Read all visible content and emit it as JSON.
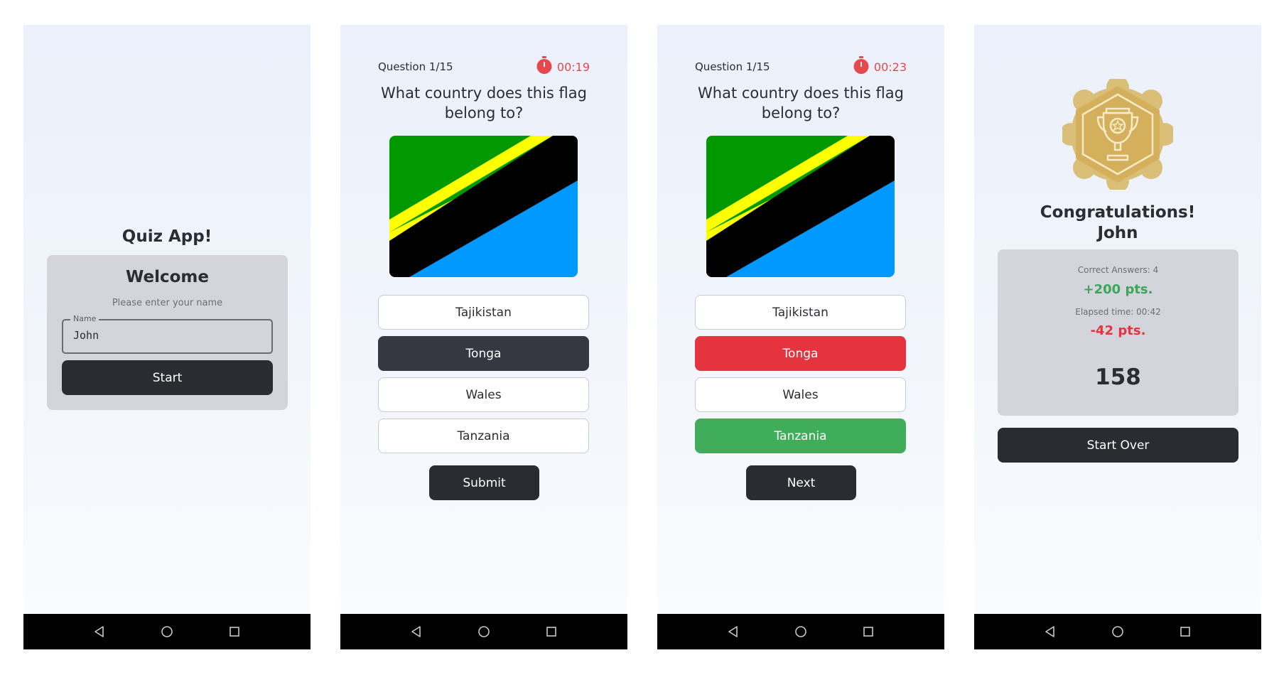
{
  "screen1": {
    "app_title": "Quiz App!",
    "welcome_title": "Welcome",
    "subtitle": "Please enter your name",
    "name_label": "Name",
    "name_value": "John",
    "start_label": "Start"
  },
  "screen2": {
    "question_label": "Question 1/15",
    "timer": "00:19",
    "question": "What country does this flag belong to?",
    "options": [
      "Tajikistan",
      "Tonga",
      "Wales",
      "Tanzania"
    ],
    "selected_option": "Tonga",
    "submit_label": "Submit"
  },
  "screen3": {
    "question_label": "Question 1/15",
    "timer": "00:23",
    "question": "What country does this flag belong to?",
    "options": [
      "Tajikistan",
      "Tonga",
      "Wales",
      "Tanzania"
    ],
    "wrong_option": "Tonga",
    "correct_option": "Tanzania",
    "next_label": "Next"
  },
  "screen4": {
    "congrats_line1": "Congratulations!",
    "congrats_line2": "John",
    "correct_answers": "Correct Answers: 4",
    "bonus_points": "+200 pts.",
    "elapsed_time": "Elapsed time: 00:42",
    "penalty_points": "-42 pts.",
    "score": "158",
    "start_over_label": "Start Over"
  },
  "nav_icons": [
    "back-triangle-icon",
    "home-circle-icon",
    "recents-square-icon"
  ],
  "colors": {
    "dark_button": "#2b2c32",
    "card_bg": "#d3d4dc",
    "timer_red": "#e5484d",
    "wrong_red": "#e5343d",
    "correct_green": "#40ad5a",
    "gold_badge": "#d9b96a",
    "flag_green": "#009a00",
    "flag_blue": "#0099ff",
    "flag_yellow": "#ffff00",
    "flag_black": "#000000"
  }
}
